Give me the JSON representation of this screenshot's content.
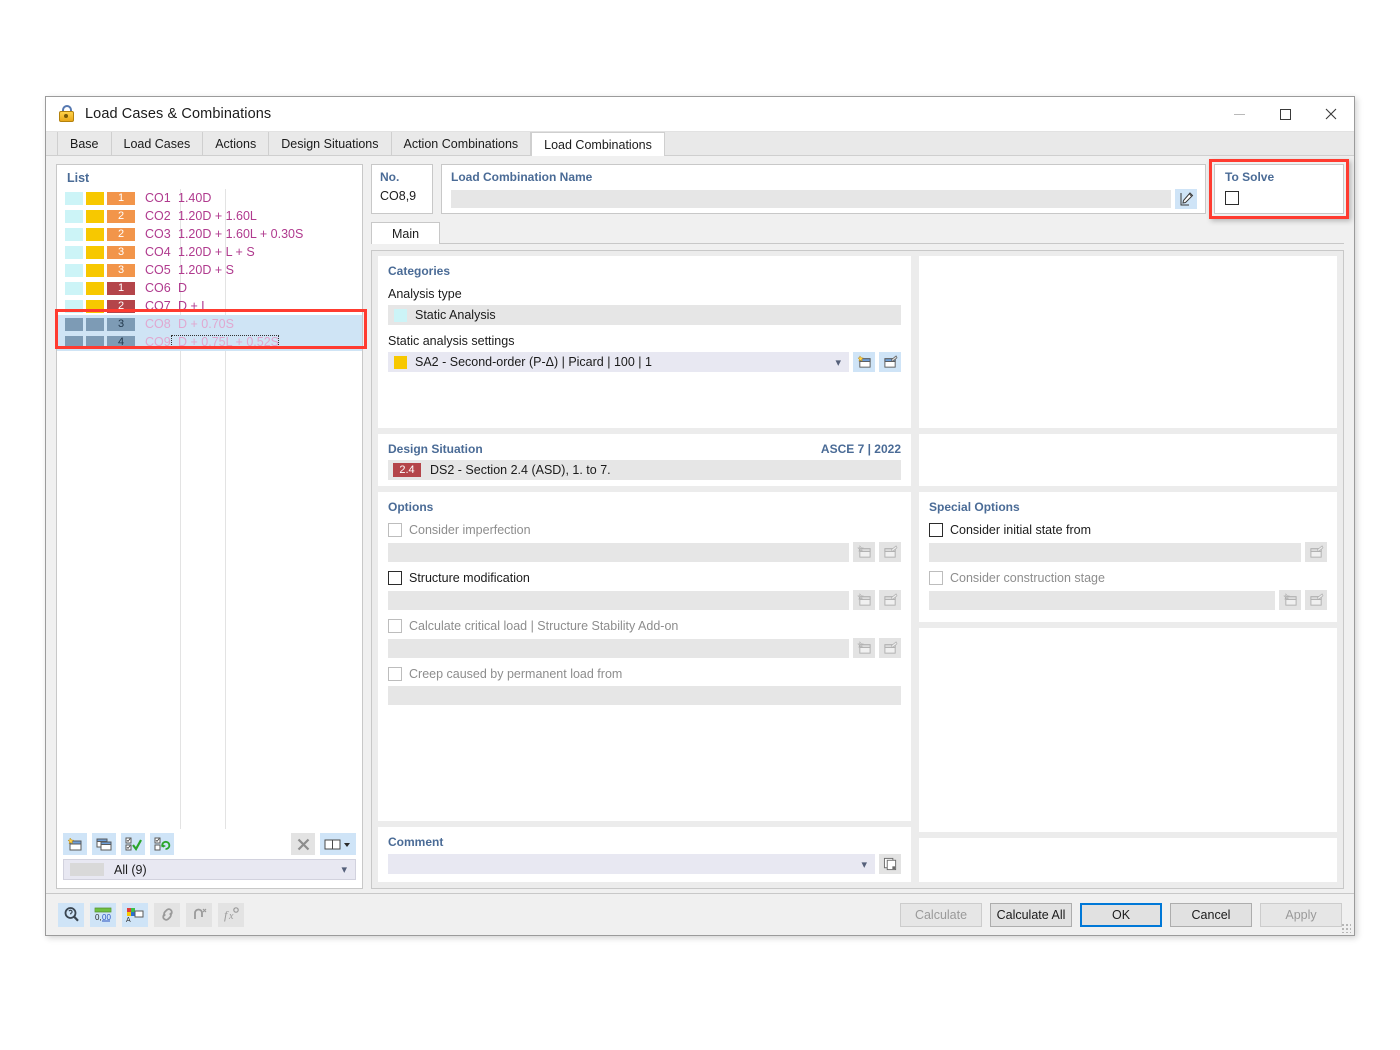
{
  "window": {
    "title": "Load Cases & Combinations",
    "icon": "padlock-icon",
    "minimize": "minimize-icon",
    "maximize": "maximize-icon",
    "close": "close-icon"
  },
  "tabs": [
    {
      "label": "Base",
      "active": false
    },
    {
      "label": "Load Cases",
      "active": false
    },
    {
      "label": "Actions",
      "active": false
    },
    {
      "label": "Design Situations",
      "active": false
    },
    {
      "label": "Action Combinations",
      "active": false
    },
    {
      "label": "Load Combinations",
      "active": true
    }
  ],
  "list": {
    "title": "List",
    "rows": [
      {
        "sw1": "#ccf4f7",
        "sw2": "#f7c800",
        "num": "1",
        "numcolor": "#f2954a",
        "co": "CO1",
        "expr": "1.40D",
        "selected": false
      },
      {
        "sw1": "#ccf4f7",
        "sw2": "#f7c800",
        "num": "2",
        "numcolor": "#f2954a",
        "co": "CO2",
        "expr": "1.20D + 1.60L",
        "selected": false
      },
      {
        "sw1": "#ccf4f7",
        "sw2": "#f7c800",
        "num": "2",
        "numcolor": "#f2954a",
        "co": "CO3",
        "expr": "1.20D + 1.60L + 0.30S",
        "selected": false
      },
      {
        "sw1": "#ccf4f7",
        "sw2": "#f7c800",
        "num": "3",
        "numcolor": "#f2954a",
        "co": "CO4",
        "expr": "1.20D + L + S",
        "selected": false
      },
      {
        "sw1": "#ccf4f7",
        "sw2": "#f7c800",
        "num": "3",
        "numcolor": "#f2954a",
        "co": "CO5",
        "expr": "1.20D + S",
        "selected": false
      },
      {
        "sw1": "#ccf4f7",
        "sw2": "#f7c800",
        "num": "1",
        "numcolor": "#b4454a",
        "co": "CO6",
        "expr": "D",
        "selected": false
      },
      {
        "sw1": "#ccf4f7",
        "sw2": "#f7c800",
        "num": "2",
        "numcolor": "#b4454a",
        "co": "CO7",
        "expr": "D + L",
        "selected": false
      },
      {
        "sw1": "#7d9bb5",
        "sw2": "#7d9bb5",
        "num": "3",
        "numcolor": "#7d9bb5",
        "co": "CO8",
        "expr": "D + 0.70S",
        "selected": true
      },
      {
        "sw1": "#7d9bb5",
        "sw2": "#7d9bb5",
        "num": "4",
        "numcolor": "#7d9bb5",
        "co": "CO9",
        "expr": "D + 0.75L + 0.52S",
        "selected": true,
        "focused": true
      }
    ],
    "toolbar": [
      {
        "name": "new-item-button",
        "icon": "new-window-icon",
        "enabled": true
      },
      {
        "name": "copy-item-button",
        "icon": "copy-window-icon",
        "enabled": true
      },
      {
        "name": "select-all-button",
        "icon": "checkbox-check-icon",
        "enabled": true
      },
      {
        "name": "invert-selection-button",
        "icon": "checkbox-refresh-icon",
        "enabled": true
      },
      {
        "name": "delete-item-button",
        "icon": "x-icon",
        "enabled": false
      },
      {
        "name": "view-columns-button",
        "icon": "two-columns-icon",
        "enabled": true
      }
    ],
    "filter": {
      "value": "All (9)",
      "caret": "chevron-down-icon"
    }
  },
  "header": {
    "no": {
      "label": "No.",
      "value": "CO8,9"
    },
    "name": {
      "label": "Load Combination Name",
      "value": "",
      "placeholder": "",
      "edit_icon": "edit-pencil-icon"
    },
    "to_solve": {
      "label": "To Solve",
      "checked": false,
      "highlighted": true
    }
  },
  "main": {
    "tab_label": "Main",
    "categories": {
      "title": "Categories",
      "analysis_type_label": "Analysis type",
      "analysis_type_value": "Static Analysis",
      "analysis_type_swatch": "#ccf4f7",
      "settings_label": "Static analysis settings",
      "settings_value": "SA2 - Second-order (P-Δ) | Picard | 100 | 1",
      "settings_swatch": "#f7c800",
      "settings_caret": "chevron-down-icon",
      "new_button": "new-window-icon",
      "edit_button": "edit-window-icon"
    },
    "design_situation": {
      "title": "Design Situation",
      "standard": "ASCE 7 | 2022",
      "badge": "2.4",
      "badge_color": "#b4454a",
      "value": "DS2 - Section 2.4 (ASD), 1. to 7."
    },
    "options": {
      "title": "Options",
      "items": [
        {
          "label": "Consider imperfection",
          "checked": false,
          "enabled": false,
          "value": "",
          "has_new": true,
          "has_edit": true
        },
        {
          "label": "Structure modification",
          "checked": false,
          "enabled": true,
          "value": "",
          "has_new": true,
          "has_edit": true
        },
        {
          "label": "Calculate critical load | Structure Stability Add-on",
          "checked": false,
          "enabled": false,
          "value": "",
          "has_new": true,
          "has_edit": true
        },
        {
          "label": "Creep caused by permanent load from",
          "checked": false,
          "enabled": false,
          "value": "",
          "has_new": false,
          "has_edit": false
        }
      ]
    },
    "special_options": {
      "title": "Special Options",
      "items": [
        {
          "label": "Consider initial state from",
          "checked": false,
          "enabled": true,
          "value": "",
          "has_new": false,
          "has_edit": true
        },
        {
          "label": "Consider construction stage",
          "checked": false,
          "enabled": false,
          "value": "",
          "has_new": true,
          "has_edit": true
        }
      ]
    },
    "comment": {
      "title": "Comment",
      "value": "",
      "caret": "chevron-down-icon",
      "copy_icon": "copy-icon"
    }
  },
  "footer": {
    "tools": [
      {
        "name": "zoom-info-button",
        "icon": "magnifier-icon",
        "enabled": true
      },
      {
        "name": "units-button",
        "icon": "number-format-icon",
        "enabled": true
      },
      {
        "name": "display-properties-button",
        "icon": "color-palette-icon",
        "enabled": true
      },
      {
        "name": "link-button",
        "icon": "chain-link-icon",
        "enabled": false
      },
      {
        "name": "reset-button",
        "icon": "undo-arrow-icon",
        "enabled": false
      },
      {
        "name": "formula-button",
        "icon": "function-icon",
        "enabled": false
      }
    ],
    "buttons": [
      {
        "label": "Calculate",
        "enabled": false,
        "primary": false
      },
      {
        "label": "Calculate All",
        "enabled": true,
        "primary": false
      },
      {
        "label": "OK",
        "enabled": true,
        "primary": true
      },
      {
        "label": "Cancel",
        "enabled": true,
        "primary": false
      },
      {
        "label": "Apply",
        "enabled": false,
        "primary": false
      }
    ]
  },
  "colors": {
    "accent_blue": "#4a6b96",
    "highlight_red": "#ff3b30",
    "selection_blue": "#cfe4f5",
    "primary_border": "#0078d7"
  }
}
